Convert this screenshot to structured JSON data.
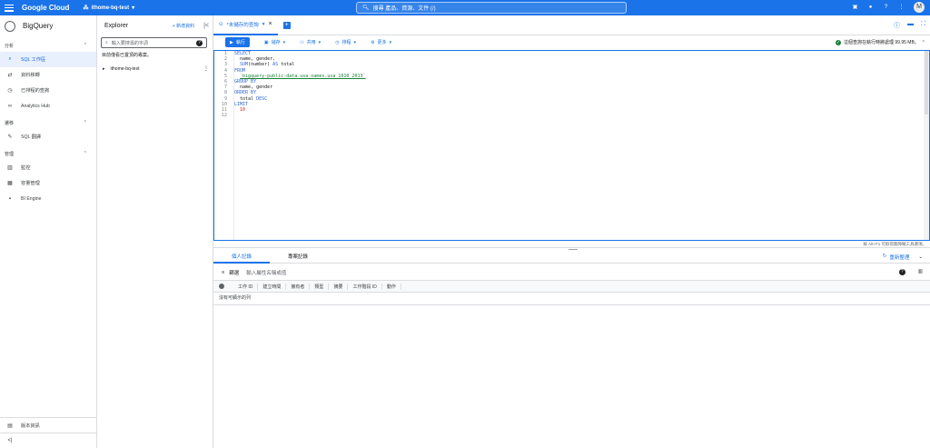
{
  "topbar": {
    "brand": "Google Cloud",
    "project": "ithome-bq-test",
    "search_placeholder": "搜尋 產品、資源、文件 (/)",
    "avatar": "M"
  },
  "leftnav": {
    "product": "BigQuery",
    "sections": [
      {
        "title": "分析",
        "items": [
          "SQL 工作區",
          "資料移轉",
          "已排程的查詢",
          "Analytics Hub"
        ]
      },
      {
        "title": "遷移",
        "items": [
          "SQL 翻譯"
        ]
      },
      {
        "title": "管理",
        "items": [
          "監控",
          "容量管理",
          "BI Engine"
        ]
      }
    ],
    "release_notes": "版本資訊",
    "collapse": "<|"
  },
  "explorer": {
    "title": "Explorer",
    "add_label": "+ 新增資料",
    "search_placeholder": "輸入要搜尋的字詞",
    "note": "目前僅看已置頂的專案。",
    "project": "ithome-bq-test"
  },
  "editor": {
    "tab_label": "*未儲存的查詢",
    "run_label": "執行",
    "save_label": "儲存",
    "share_label": "共用",
    "schedule_label": "排程",
    "more_label": "更多",
    "validation": "這個查詢在執行時將處理 99.95 MB。",
    "lines": [
      "1",
      "2",
      "3",
      "4",
      "5",
      "6",
      "7",
      "8",
      "9",
      "10",
      "11",
      "12"
    ],
    "status": "按 Alt+F1 可取得無障礙工具選項。"
  },
  "history": {
    "tabs": [
      "個人記錄",
      "專案記錄"
    ],
    "refresh": "重新整理",
    "filter_label": "篩選",
    "filter_placeholder": "輸入屬性名稱或值",
    "columns": [
      "工作 ID",
      "建立時間",
      "擁有者",
      "類型",
      "摘要",
      "工作階段 ID",
      "動作"
    ],
    "empty": "沒有可顯示的列"
  }
}
